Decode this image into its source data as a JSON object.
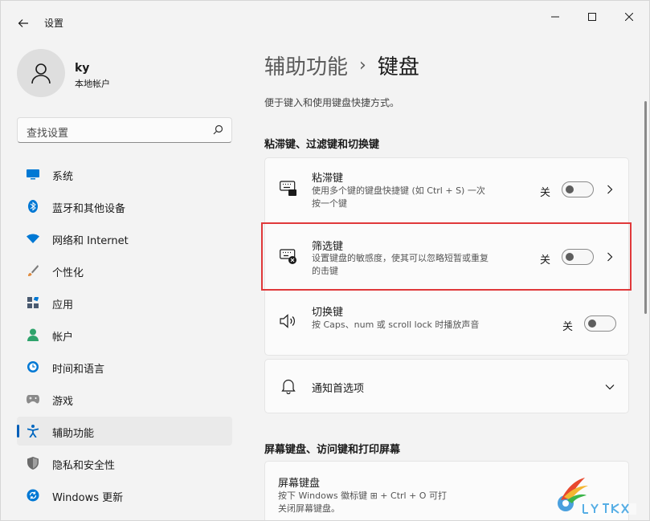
{
  "app": {
    "title": "设置"
  },
  "user": {
    "name": "ky",
    "account_type": "本地帐户"
  },
  "search": {
    "placeholder": "查找设置"
  },
  "nav": [
    {
      "label": "系统",
      "icon": "monitor-icon",
      "color": "#0078d4"
    },
    {
      "label": "蓝牙和其他设备",
      "icon": "bluetooth-icon",
      "color": "#0078d4"
    },
    {
      "label": "网络和 Internet",
      "icon": "wifi-icon",
      "color": "#0078d4"
    },
    {
      "label": "个性化",
      "icon": "brush-icon",
      "color": "#e08a3c"
    },
    {
      "label": "应用",
      "icon": "apps-icon",
      "color": "#4a5a70"
    },
    {
      "label": "帐户",
      "icon": "account-icon",
      "color": "#2ea36b"
    },
    {
      "label": "时间和语言",
      "icon": "clock-globe-icon",
      "color": "#0078d4"
    },
    {
      "label": "游戏",
      "icon": "gamepad-icon",
      "color": "#7a7a7a"
    },
    {
      "label": "辅助功能",
      "icon": "accessibility-icon",
      "color": "#0067c0",
      "active": true
    },
    {
      "label": "隐私和安全性",
      "icon": "shield-icon",
      "color": "#6b6b6b"
    },
    {
      "label": "Windows 更新",
      "icon": "update-icon",
      "color": "#0078d4"
    }
  ],
  "breadcrumb": {
    "parent": "辅助功能",
    "separator": "›",
    "current": "键盘"
  },
  "page_description": "便于键入和使用键盘快捷方式。",
  "sections": {
    "keys": {
      "title": "粘滞键、过滤键和切换键",
      "sticky": {
        "title": "粘滞键",
        "desc": "使用多个键的键盘快捷键 (如 Ctrl + S) 一次按一个键",
        "state": "关"
      },
      "filter": {
        "title": "筛选键",
        "desc": "设置键盘的敏感度，使其可以忽略短暂或重复的击键",
        "state": "关"
      },
      "toggle": {
        "title": "切换键",
        "desc": "按 Caps、num 或 scroll lock 时播放声音",
        "state": "关"
      }
    },
    "notifications": {
      "title": "通知首选项"
    },
    "screen": {
      "title": "屏幕键盘、访问键和打印屏幕",
      "osk": {
        "title": "屏幕键盘",
        "desc_line1": "按下 Windows 徽标键 ⊞ + Ctrl + O 可打",
        "desc_line2": "关闭屏幕键盘。"
      }
    }
  },
  "colors": {
    "accent": "#005fb8",
    "highlight": "#e0383a"
  }
}
